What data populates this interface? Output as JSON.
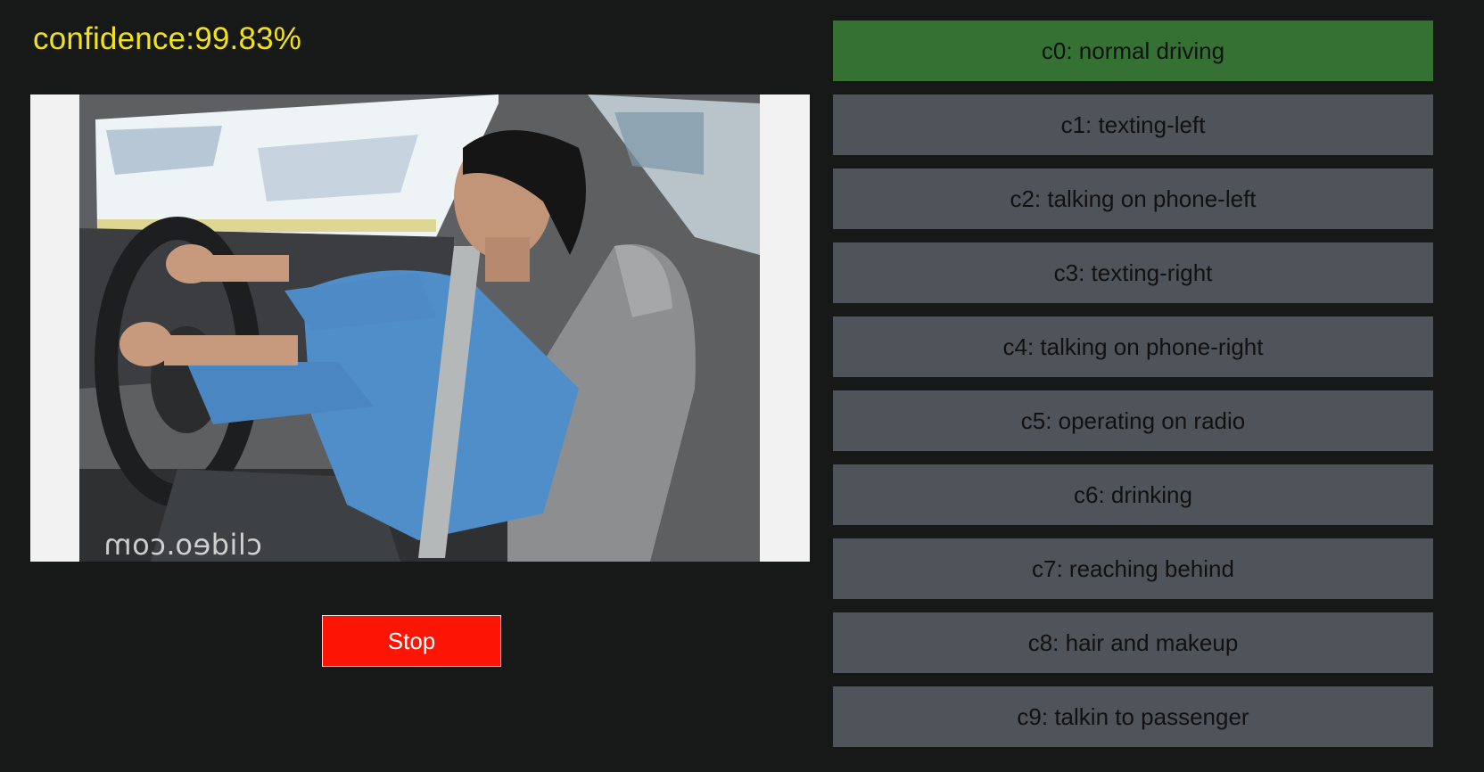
{
  "confidence_label": "confidence:99.83%",
  "watermark": "clideo.com",
  "stop_button": {
    "label": "Stop"
  },
  "classes": [
    {
      "label": "c0: normal driving",
      "active": true
    },
    {
      "label": "c1: texting-left",
      "active": false
    },
    {
      "label": "c2: talking on phone-left",
      "active": false
    },
    {
      "label": "c3: texting-right",
      "active": false
    },
    {
      "label": "c4: talking on phone-right",
      "active": false
    },
    {
      "label": "c5: operating on radio",
      "active": false
    },
    {
      "label": "c6: drinking",
      "active": false
    },
    {
      "label": "c7: reaching behind",
      "active": false
    },
    {
      "label": "c8: hair and makeup",
      "active": false
    },
    {
      "label": "c9: talkin to passenger",
      "active": false
    }
  ],
  "colors": {
    "background": "#171818",
    "confidence_text": "#f2e21a",
    "active_class": "#357132",
    "inactive_class": "#4f535a",
    "stop_button": "#fc1405"
  }
}
